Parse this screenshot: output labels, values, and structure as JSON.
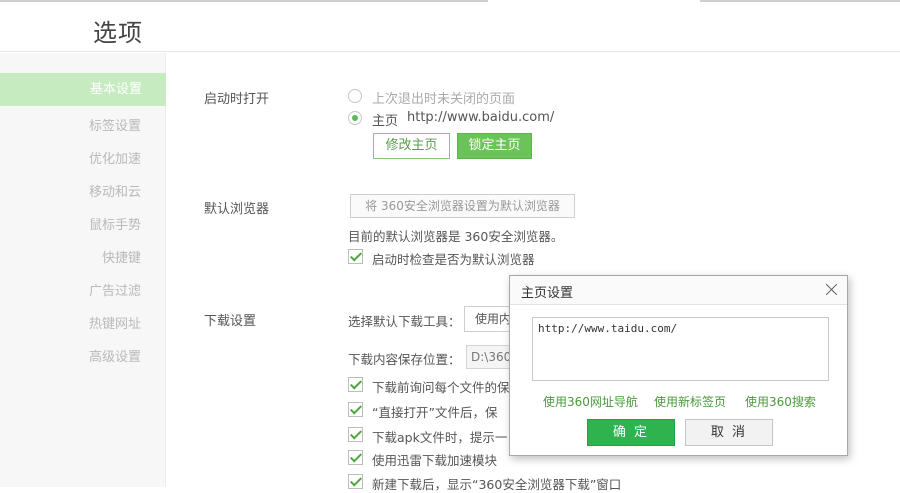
{
  "header": {
    "title": "选项"
  },
  "sidebar": {
    "items": [
      {
        "label": "基本设置",
        "active": true
      },
      {
        "label": "标签设置"
      },
      {
        "label": "优化加速"
      },
      {
        "label": "移动和云"
      },
      {
        "label": "鼠标手势"
      },
      {
        "label": "快捷键"
      },
      {
        "label": "广告过滤"
      },
      {
        "label": "热键网址"
      },
      {
        "label": "高级设置"
      }
    ]
  },
  "startup": {
    "label": "启动时打开",
    "option_last": "上次退出时未关闭的页面",
    "option_home": "主页",
    "home_url": "http://www.baidu.com/",
    "edit_home_button": "修改主页",
    "lock_home_button": "锁定主页"
  },
  "default_browser": {
    "label": "默认浏览器",
    "set_default_button": "将 360安全浏览器设置为默认浏览器",
    "status": "目前的默认浏览器是 360安全浏览器。",
    "check_on_start": "启动时检查是否为默认浏览器"
  },
  "download": {
    "label": "下载设置",
    "tool_label": "选择默认下载工具：",
    "tool_value": "使用内",
    "path_label": "下载内容保存位置：",
    "path_value": "D:\\360",
    "options": [
      "下载前询问每个文件的保",
      "“直接打开”文件后，保",
      "下载apk文件时，提示一",
      "使用迅雷下载加速模块",
      "新建下载后，显示“360安全浏览器下载”窗口"
    ]
  },
  "dialog": {
    "title": "主页设置",
    "url_value": "http://www.taidu.com/",
    "link_nav": "使用360网址导航",
    "link_newtab": "使用新标签页",
    "link_search": "使用360搜索",
    "ok_button": "确 定",
    "cancel_button": "取 消"
  }
}
